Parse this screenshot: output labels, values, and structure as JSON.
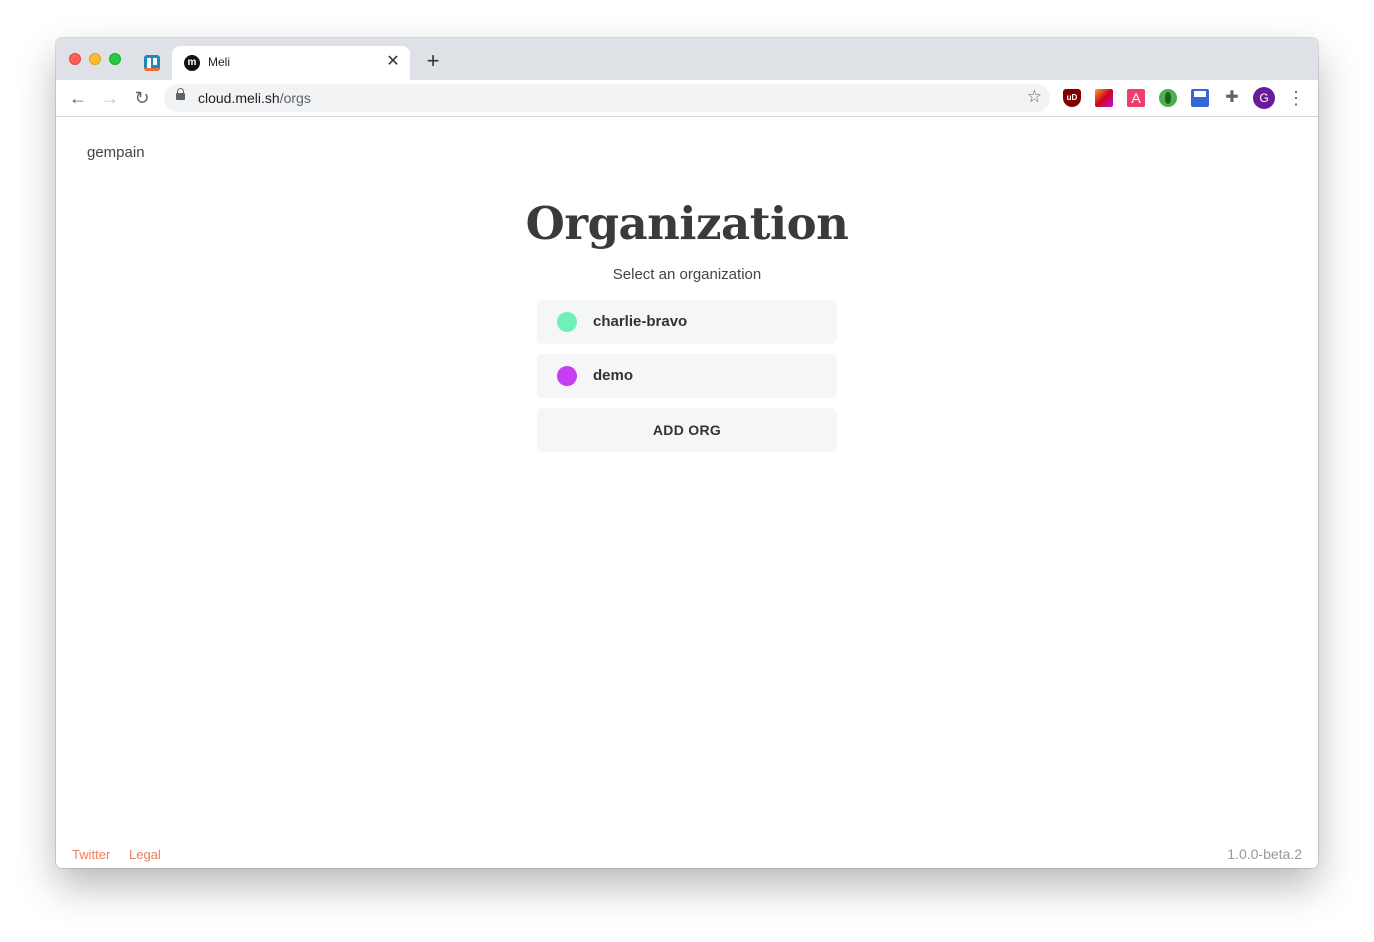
{
  "browser": {
    "tab_title": "Meli",
    "tab_favicon": "m",
    "url_host": "cloud.meli.sh",
    "url_path": "/orgs",
    "profile_initial": "G",
    "extension_a_label": "A",
    "extension_ub_label": "uD"
  },
  "header": {
    "username": "gempain"
  },
  "main": {
    "title": "Organization",
    "subtitle": "Select an organization",
    "orgs": [
      {
        "name": "charlie-bravo",
        "color": "#6ff0b9"
      },
      {
        "name": "demo",
        "color": "#c63ef0"
      }
    ],
    "add_org_label": "ADD ORG"
  },
  "footer": {
    "links": [
      "Twitter",
      "Legal"
    ],
    "version": "1.0.0-beta.2"
  },
  "colors": {
    "footer_link": "#f07d5e",
    "version": "#999999"
  }
}
